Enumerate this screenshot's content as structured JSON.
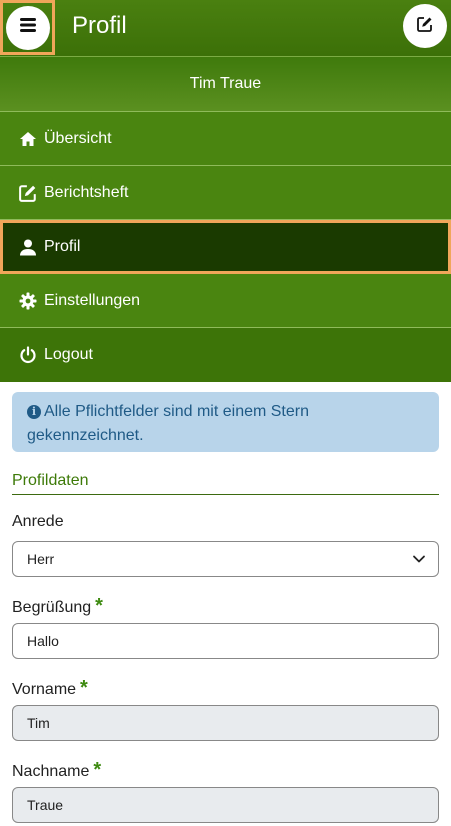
{
  "header": {
    "title": "Profil",
    "menu_icon": "hamburger-icon",
    "edit_icon": "edit-icon"
  },
  "nav": {
    "user_name": "Tim Traue",
    "items": [
      {
        "label": "Übersicht",
        "icon": "home-icon"
      },
      {
        "label": "Berichtsheft",
        "icon": "edit-icon"
      },
      {
        "label": "Profil",
        "icon": "user-icon"
      },
      {
        "label": "Einstellungen",
        "icon": "gear-icon"
      },
      {
        "label": "Logout",
        "icon": "power-icon"
      }
    ]
  },
  "content": {
    "alert": "Alle Pflichtfelder sind mit einem Stern gekennzeichnet.",
    "section_title": "Profildaten",
    "fields": [
      {
        "label": "Anrede",
        "value": "Herr",
        "required": false
      },
      {
        "label": "Begrüßung",
        "value": "Hallo",
        "required": true
      },
      {
        "label": "Vorname",
        "value": "Tim",
        "required": true
      },
      {
        "label": "Nachname",
        "value": "Traue",
        "required": true
      }
    ]
  },
  "colors": {
    "accent": "#4a8510",
    "active_nav": "#1a3a00",
    "highlight": "#f0a65a"
  }
}
